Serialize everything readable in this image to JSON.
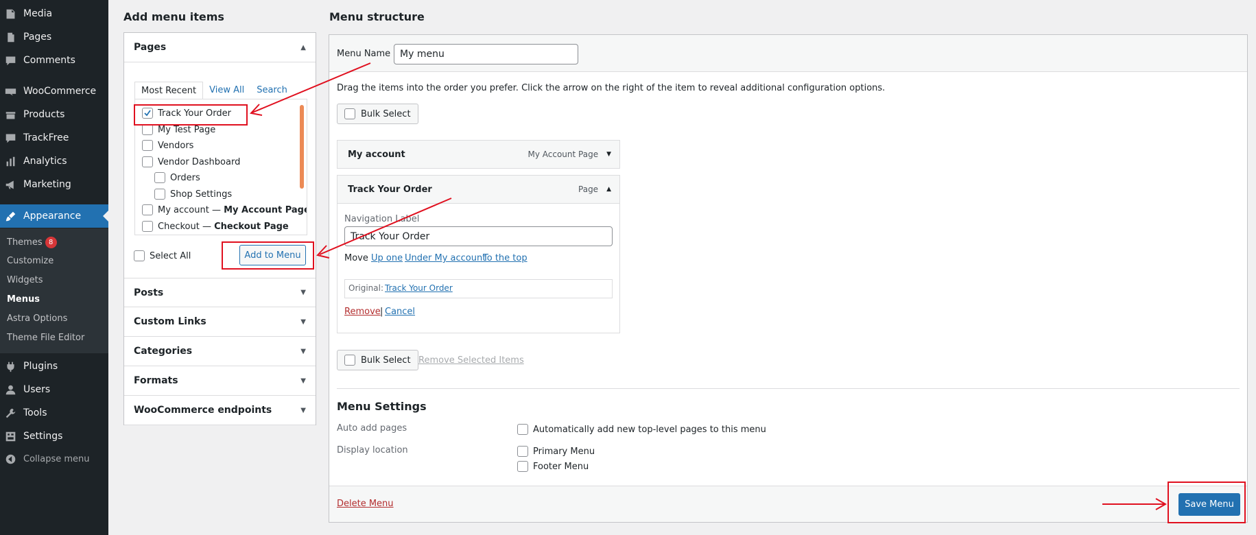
{
  "sidebar": {
    "items": [
      {
        "label": "Media",
        "icon": "media-icon"
      },
      {
        "label": "Pages",
        "icon": "pages-icon"
      },
      {
        "label": "Comments",
        "icon": "comments-icon"
      },
      {
        "label": "WooCommerce",
        "icon": "woocommerce-icon"
      },
      {
        "label": "Products",
        "icon": "products-icon"
      },
      {
        "label": "TrackFree",
        "icon": "trackfree-icon"
      },
      {
        "label": "Analytics",
        "icon": "analytics-icon"
      },
      {
        "label": "Marketing",
        "icon": "megaphone-icon"
      },
      {
        "label": "Appearance",
        "icon": "paintbrush-icon"
      },
      {
        "label": "Plugins",
        "icon": "plugin-icon"
      },
      {
        "label": "Users",
        "icon": "users-icon"
      },
      {
        "label": "Tools",
        "icon": "wrench-icon"
      },
      {
        "label": "Settings",
        "icon": "settings-icon"
      },
      {
        "label": "Collapse menu",
        "icon": "collapse-icon"
      }
    ],
    "submenu": {
      "themes": "Themes",
      "themes_badge": "8",
      "customize": "Customize",
      "widgets": "Widgets",
      "menus": "Menus",
      "astra": "Astra Options",
      "theme_editor": "Theme File Editor"
    }
  },
  "add_items": {
    "heading": "Add menu items",
    "pages_section": "Pages",
    "tabs": [
      "Most Recent",
      "View All",
      "Search"
    ],
    "pages": [
      {
        "label": "Track Your Order",
        "checked": true
      },
      {
        "label": "My Test Page",
        "checked": false
      },
      {
        "label": "Vendors",
        "checked": false
      },
      {
        "label": "Vendor Dashboard",
        "checked": false
      },
      {
        "label": "Orders",
        "checked": false
      },
      {
        "label": "Shop Settings",
        "checked": false
      },
      {
        "label": "My account — ",
        "suffix": "My Account Page",
        "checked": false
      },
      {
        "label": "Checkout — ",
        "suffix": "Checkout Page",
        "checked": false
      }
    ],
    "select_all": "Select All",
    "add_button": "Add to Menu",
    "sections": [
      "Posts",
      "Custom Links",
      "Categories",
      "Formats",
      "WooCommerce endpoints"
    ]
  },
  "structure": {
    "heading": "Menu structure",
    "menu_name_label": "Menu Name",
    "menu_name_value": "My menu",
    "instructions": "Drag the items into the order you prefer. Click the arrow on the right of the item to reveal additional configuration options.",
    "bulk_select": "Bulk Select",
    "items": [
      {
        "title": "My account",
        "type": "My Account Page"
      },
      {
        "title": "Track Your Order",
        "type": "Page"
      }
    ],
    "edit": {
      "nav_label": "Navigation Label",
      "nav_value": "Track Your Order",
      "move": "Move",
      "up_one": "Up one",
      "under": "Under My account",
      "to_top": "To the top",
      "original_label": "Original:",
      "original_link": "Track Your Order",
      "remove": "Remove",
      "sep": "|",
      "cancel": "Cancel"
    },
    "remove_selected": "Remove Selected Items"
  },
  "settings": {
    "heading": "Menu Settings",
    "auto_add_label": "Auto add pages",
    "auto_add_option": "Automatically add new top-level pages to this menu",
    "display_location_label": "Display location",
    "locations": [
      "Primary Menu",
      "Footer Menu"
    ]
  },
  "footer": {
    "delete": "Delete Menu",
    "save": "Save Menu"
  },
  "colors": {
    "accent": "#2271b1",
    "sidebar_bg": "#1d2327",
    "annotation_red": "#e0101f",
    "danger": "#b32d2e"
  }
}
